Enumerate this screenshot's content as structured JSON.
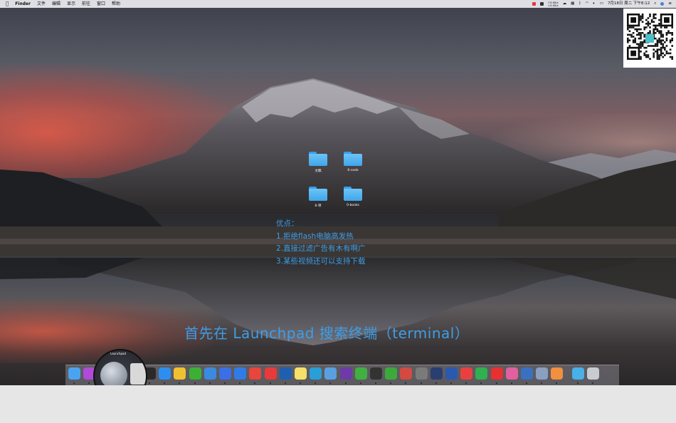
{
  "menubar": {
    "apple": "",
    "items": [
      "Finder",
      "文件",
      "编辑",
      "显示",
      "前往",
      "窗口",
      "帮助"
    ],
    "network_up": "7.8 KB/s",
    "network_down": "1.6 KB/s",
    "datetime": "7月18日 周二 下午8:12"
  },
  "desktop": {
    "folders": [
      {
        "label": "文稿"
      },
      {
        "label": "6-code"
      },
      {
        "label": "6-项"
      },
      {
        "label": "0-books"
      }
    ]
  },
  "overlay": {
    "pros_title": "优点：",
    "pros_items": [
      "1.拒绝flash电脑高发热",
      "2.直接过滤广告有木有啊广",
      "3.某些视频还可以支持下载"
    ],
    "caption": "首先在 Launchpad 搜索终端（terminal）"
  },
  "dock": {
    "magnifier_label": "Launchpad",
    "apps": [
      {
        "name": "finder",
        "color": "#4aa3ef"
      },
      {
        "name": "siri",
        "color": "#b04ad8"
      },
      {
        "name": "launchpad",
        "color": "#8a929e"
      },
      {
        "name": "calculator",
        "color": "#d8d8d8"
      },
      {
        "name": "activity-monitor",
        "color": "#1e1e1e"
      },
      {
        "name": "terminal",
        "color": "#2a2a2a"
      },
      {
        "name": "qq-chat",
        "color": "#2d8ef0"
      },
      {
        "name": "qq",
        "color": "#f0c030"
      },
      {
        "name": "wechat",
        "color": "#3cb034"
      },
      {
        "name": "edge-browser",
        "color": "#3a8be0"
      },
      {
        "name": "feishu",
        "color": "#3a6fe8"
      },
      {
        "name": "safari",
        "color": "#2f7be8"
      },
      {
        "name": "chrome",
        "color": "#e8453c"
      },
      {
        "name": "weibo",
        "color": "#e83a3a"
      },
      {
        "name": "media-player",
        "color": "#1f5fb0"
      },
      {
        "name": "notes",
        "color": "#f5e06a"
      },
      {
        "name": "markdown",
        "color": "#2a9ed8"
      },
      {
        "name": "preview",
        "color": "#5aa0e0"
      },
      {
        "name": "github",
        "color": "#6e3aa8"
      },
      {
        "name": "evernote",
        "color": "#40b040"
      },
      {
        "name": "circle-app",
        "color": "#333333"
      },
      {
        "name": "camtasia",
        "color": "#3caa3a"
      },
      {
        "name": "cherry",
        "color": "#d24a40"
      },
      {
        "name": "film",
        "color": "#7a7a7a"
      },
      {
        "name": "pen",
        "color": "#2a3e70"
      },
      {
        "name": "word",
        "color": "#2a5ab0"
      },
      {
        "name": "arrow",
        "color": "#e84040"
      },
      {
        "name": "wing",
        "color": "#30b050"
      },
      {
        "name": "youdao",
        "color": "#e83030"
      },
      {
        "name": "screen",
        "color": "#e060a0"
      },
      {
        "name": "globe",
        "color": "#3a70c0"
      },
      {
        "name": "folder-window",
        "color": "#8aa0c0"
      },
      {
        "name": "peach",
        "color": "#f09040"
      },
      {
        "name": "downloads",
        "color": "#4ab0e8"
      },
      {
        "name": "trash",
        "color": "#c8ccd0"
      }
    ]
  }
}
